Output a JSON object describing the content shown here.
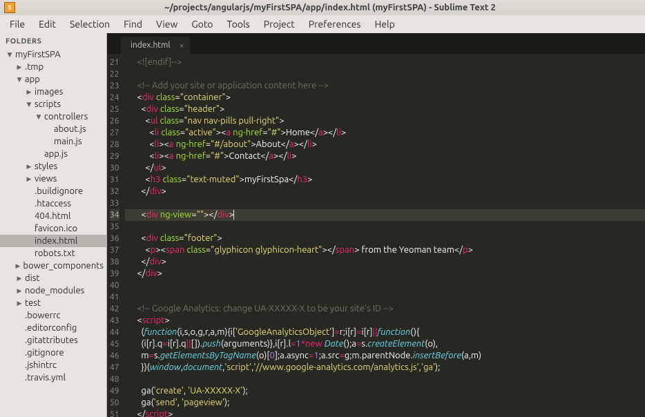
{
  "titlebar": {
    "icon_text": "S",
    "title": "~/projects/angularjs/myFirstSPA/app/index.html (myFirstSPA) - Sublime Text 2"
  },
  "menubar": [
    "File",
    "Edit",
    "Selection",
    "Find",
    "View",
    "Goto",
    "Tools",
    "Project",
    "Preferences",
    "Help"
  ],
  "sidebar": {
    "heading": "FOLDERS",
    "tree": [
      {
        "depth": 0,
        "arrow": "down",
        "label": "myFirstSPA"
      },
      {
        "depth": 1,
        "arrow": "right",
        "label": ".tmp"
      },
      {
        "depth": 1,
        "arrow": "down",
        "label": "app"
      },
      {
        "depth": 2,
        "arrow": "right",
        "label": "images"
      },
      {
        "depth": 2,
        "arrow": "down",
        "label": "scripts"
      },
      {
        "depth": 3,
        "arrow": "down",
        "label": "controllers"
      },
      {
        "depth": 4,
        "arrow": "",
        "label": "about.js"
      },
      {
        "depth": 4,
        "arrow": "",
        "label": "main.js"
      },
      {
        "depth": 3,
        "arrow": "",
        "label": "app.js"
      },
      {
        "depth": 2,
        "arrow": "right",
        "label": "styles"
      },
      {
        "depth": 2,
        "arrow": "right",
        "label": "views"
      },
      {
        "depth": 2,
        "arrow": "",
        "label": ".buildignore"
      },
      {
        "depth": 2,
        "arrow": "",
        "label": ".htaccess"
      },
      {
        "depth": 2,
        "arrow": "",
        "label": "404.html"
      },
      {
        "depth": 2,
        "arrow": "",
        "label": "favicon.ico"
      },
      {
        "depth": 2,
        "arrow": "",
        "label": "index.html",
        "selected": true
      },
      {
        "depth": 2,
        "arrow": "",
        "label": "robots.txt"
      },
      {
        "depth": 1,
        "arrow": "right",
        "label": "bower_components"
      },
      {
        "depth": 1,
        "arrow": "right",
        "label": "dist"
      },
      {
        "depth": 1,
        "arrow": "right",
        "label": "node_modules"
      },
      {
        "depth": 1,
        "arrow": "right",
        "label": "test"
      },
      {
        "depth": 1,
        "arrow": "",
        "label": ".bowerrc"
      },
      {
        "depth": 1,
        "arrow": "",
        "label": ".editorconfig"
      },
      {
        "depth": 1,
        "arrow": "",
        "label": ".gitattributes"
      },
      {
        "depth": 1,
        "arrow": "",
        "label": ".gitignore"
      },
      {
        "depth": 1,
        "arrow": "",
        "label": ".jshintrc"
      },
      {
        "depth": 1,
        "arrow": "",
        "label": ".travis.yml"
      }
    ]
  },
  "tab": {
    "label": "index.html"
  },
  "gutter": {
    "start": 21,
    "end": 51,
    "highlight": 34
  },
  "code_lines": [
    {
      "n": 21,
      "seg": [
        {
          "cls": "c-text",
          "t": "    "
        },
        {
          "cls": "c-comment",
          "t": "<![endif]-->"
        }
      ]
    },
    {
      "n": 22,
      "seg": []
    },
    {
      "n": 23,
      "seg": [
        {
          "cls": "c-text",
          "t": "    "
        },
        {
          "cls": "c-comment",
          "t": "<!-- Add your site or application content here -->"
        }
      ]
    },
    {
      "n": 24,
      "seg": [
        {
          "cls": "c-text",
          "t": "    "
        },
        {
          "cls": "c-punc",
          "t": "<"
        },
        {
          "cls": "c-tag",
          "t": "div"
        },
        {
          "cls": "c-text",
          "t": " "
        },
        {
          "cls": "c-attr",
          "t": "class"
        },
        {
          "cls": "c-punc",
          "t": "="
        },
        {
          "cls": "c-string",
          "t": "\"container\""
        },
        {
          "cls": "c-punc",
          "t": ">"
        }
      ]
    },
    {
      "n": 25,
      "seg": [
        {
          "cls": "c-text",
          "t": "      "
        },
        {
          "cls": "c-punc",
          "t": "<"
        },
        {
          "cls": "c-tag",
          "t": "div"
        },
        {
          "cls": "c-text",
          "t": " "
        },
        {
          "cls": "c-attr",
          "t": "class"
        },
        {
          "cls": "c-punc",
          "t": "="
        },
        {
          "cls": "c-string",
          "t": "\"header\""
        },
        {
          "cls": "c-punc",
          "t": ">"
        }
      ]
    },
    {
      "n": 26,
      "seg": [
        {
          "cls": "c-text",
          "t": "        "
        },
        {
          "cls": "c-punc",
          "t": "<"
        },
        {
          "cls": "c-tag",
          "t": "ul"
        },
        {
          "cls": "c-text",
          "t": " "
        },
        {
          "cls": "c-attr",
          "t": "class"
        },
        {
          "cls": "c-punc",
          "t": "="
        },
        {
          "cls": "c-string",
          "t": "\"nav nav-pills pull-right\""
        },
        {
          "cls": "c-punc",
          "t": ">"
        }
      ]
    },
    {
      "n": 27,
      "seg": [
        {
          "cls": "c-text",
          "t": "          "
        },
        {
          "cls": "c-punc",
          "t": "<"
        },
        {
          "cls": "c-tag",
          "t": "li"
        },
        {
          "cls": "c-text",
          "t": " "
        },
        {
          "cls": "c-attr",
          "t": "class"
        },
        {
          "cls": "c-punc",
          "t": "="
        },
        {
          "cls": "c-string",
          "t": "\"active\""
        },
        {
          "cls": "c-punc",
          "t": "><"
        },
        {
          "cls": "c-tag",
          "t": "a"
        },
        {
          "cls": "c-text",
          "t": " "
        },
        {
          "cls": "c-attr",
          "t": "ng-href"
        },
        {
          "cls": "c-punc",
          "t": "="
        },
        {
          "cls": "c-string",
          "t": "\"#\""
        },
        {
          "cls": "c-punc",
          "t": ">"
        },
        {
          "cls": "c-text",
          "t": "Home"
        },
        {
          "cls": "c-punc",
          "t": "</"
        },
        {
          "cls": "c-tag",
          "t": "a"
        },
        {
          "cls": "c-punc",
          "t": "></"
        },
        {
          "cls": "c-tag",
          "t": "li"
        },
        {
          "cls": "c-punc",
          "t": ">"
        }
      ]
    },
    {
      "n": 28,
      "seg": [
        {
          "cls": "c-text",
          "t": "          "
        },
        {
          "cls": "c-punc",
          "t": "<"
        },
        {
          "cls": "c-tag",
          "t": "li"
        },
        {
          "cls": "c-punc",
          "t": "><"
        },
        {
          "cls": "c-tag",
          "t": "a"
        },
        {
          "cls": "c-text",
          "t": " "
        },
        {
          "cls": "c-attr",
          "t": "ng-href"
        },
        {
          "cls": "c-punc",
          "t": "="
        },
        {
          "cls": "c-string",
          "t": "\"#/about\""
        },
        {
          "cls": "c-punc",
          "t": ">"
        },
        {
          "cls": "c-text",
          "t": "About"
        },
        {
          "cls": "c-punc",
          "t": "</"
        },
        {
          "cls": "c-tag",
          "t": "a"
        },
        {
          "cls": "c-punc",
          "t": "></"
        },
        {
          "cls": "c-tag",
          "t": "li"
        },
        {
          "cls": "c-punc",
          "t": ">"
        }
      ]
    },
    {
      "n": 29,
      "seg": [
        {
          "cls": "c-text",
          "t": "          "
        },
        {
          "cls": "c-punc",
          "t": "<"
        },
        {
          "cls": "c-tag",
          "t": "li"
        },
        {
          "cls": "c-punc",
          "t": "><"
        },
        {
          "cls": "c-tag",
          "t": "a"
        },
        {
          "cls": "c-text",
          "t": " "
        },
        {
          "cls": "c-attr",
          "t": "ng-href"
        },
        {
          "cls": "c-punc",
          "t": "="
        },
        {
          "cls": "c-string",
          "t": "\"#\""
        },
        {
          "cls": "c-punc",
          "t": ">"
        },
        {
          "cls": "c-text",
          "t": "Contact"
        },
        {
          "cls": "c-punc",
          "t": "</"
        },
        {
          "cls": "c-tag",
          "t": "a"
        },
        {
          "cls": "c-punc",
          "t": "></"
        },
        {
          "cls": "c-tag",
          "t": "li"
        },
        {
          "cls": "c-punc",
          "t": ">"
        }
      ]
    },
    {
      "n": 30,
      "seg": [
        {
          "cls": "c-text",
          "t": "        "
        },
        {
          "cls": "c-punc",
          "t": "</"
        },
        {
          "cls": "c-tag",
          "t": "ul"
        },
        {
          "cls": "c-punc",
          "t": ">"
        }
      ]
    },
    {
      "n": 31,
      "seg": [
        {
          "cls": "c-text",
          "t": "        "
        },
        {
          "cls": "c-punc",
          "t": "<"
        },
        {
          "cls": "c-tag",
          "t": "h3"
        },
        {
          "cls": "c-text",
          "t": " "
        },
        {
          "cls": "c-attr",
          "t": "class"
        },
        {
          "cls": "c-punc",
          "t": "="
        },
        {
          "cls": "c-string",
          "t": "\"text-muted\""
        },
        {
          "cls": "c-punc",
          "t": ">"
        },
        {
          "cls": "c-text",
          "t": "myFirstSpa"
        },
        {
          "cls": "c-punc",
          "t": "</"
        },
        {
          "cls": "c-tag",
          "t": "h3"
        },
        {
          "cls": "c-punc",
          "t": ">"
        }
      ]
    },
    {
      "n": 32,
      "seg": [
        {
          "cls": "c-text",
          "t": "      "
        },
        {
          "cls": "c-punc",
          "t": "</"
        },
        {
          "cls": "c-tag",
          "t": "div"
        },
        {
          "cls": "c-punc",
          "t": ">"
        }
      ]
    },
    {
      "n": 33,
      "seg": []
    },
    {
      "n": 34,
      "hl": true,
      "seg": [
        {
          "cls": "c-text",
          "t": "      "
        },
        {
          "cls": "c-punc",
          "t": "<"
        },
        {
          "cls": "c-tag",
          "t": "div"
        },
        {
          "cls": "c-text",
          "t": " "
        },
        {
          "cls": "c-attr",
          "t": "ng-view"
        },
        {
          "cls": "c-punc",
          "t": "="
        },
        {
          "cls": "c-string",
          "t": "\"\""
        },
        {
          "cls": "c-punc",
          "t": "></"
        },
        {
          "cls": "c-tag",
          "t": "div"
        },
        {
          "cls": "c-punc",
          "t": ">"
        },
        {
          "cls": "cursor",
          "t": ""
        }
      ]
    },
    {
      "n": 35,
      "seg": []
    },
    {
      "n": 36,
      "seg": [
        {
          "cls": "c-text",
          "t": "      "
        },
        {
          "cls": "c-punc",
          "t": "<"
        },
        {
          "cls": "c-tag",
          "t": "div"
        },
        {
          "cls": "c-text",
          "t": " "
        },
        {
          "cls": "c-attr",
          "t": "class"
        },
        {
          "cls": "c-punc",
          "t": "="
        },
        {
          "cls": "c-string",
          "t": "\"footer\""
        },
        {
          "cls": "c-punc",
          "t": ">"
        }
      ]
    },
    {
      "n": 37,
      "seg": [
        {
          "cls": "c-text",
          "t": "        "
        },
        {
          "cls": "c-punc",
          "t": "<"
        },
        {
          "cls": "c-tag",
          "t": "p"
        },
        {
          "cls": "c-punc",
          "t": "><"
        },
        {
          "cls": "c-tag",
          "t": "span"
        },
        {
          "cls": "c-text",
          "t": " "
        },
        {
          "cls": "c-attr",
          "t": "class"
        },
        {
          "cls": "c-punc",
          "t": "="
        },
        {
          "cls": "c-string",
          "t": "\"glyphicon glyphicon-heart\""
        },
        {
          "cls": "c-punc",
          "t": "></"
        },
        {
          "cls": "c-tag",
          "t": "span"
        },
        {
          "cls": "c-punc",
          "t": ">"
        },
        {
          "cls": "c-text",
          "t": " from the Yeoman team"
        },
        {
          "cls": "c-punc",
          "t": "</"
        },
        {
          "cls": "c-tag",
          "t": "p"
        },
        {
          "cls": "c-punc",
          "t": ">"
        }
      ]
    },
    {
      "n": 38,
      "seg": [
        {
          "cls": "c-text",
          "t": "      "
        },
        {
          "cls": "c-punc",
          "t": "</"
        },
        {
          "cls": "c-tag",
          "t": "div"
        },
        {
          "cls": "c-punc",
          "t": ">"
        }
      ]
    },
    {
      "n": 39,
      "seg": [
        {
          "cls": "c-text",
          "t": "    "
        },
        {
          "cls": "c-punc",
          "t": "</"
        },
        {
          "cls": "c-tag",
          "t": "div"
        },
        {
          "cls": "c-punc",
          "t": ">"
        }
      ]
    },
    {
      "n": 40,
      "seg": []
    },
    {
      "n": 41,
      "seg": []
    },
    {
      "n": 42,
      "seg": [
        {
          "cls": "c-text",
          "t": "    "
        },
        {
          "cls": "c-comment",
          "t": "<!-- Google Analytics: change UA-XXXXX-X to be your site's ID -->"
        }
      ]
    },
    {
      "n": 43,
      "seg": [
        {
          "cls": "c-text",
          "t": "    "
        },
        {
          "cls": "c-punc",
          "t": "<"
        },
        {
          "cls": "c-tag",
          "t": "script"
        },
        {
          "cls": "c-punc",
          "t": ">"
        }
      ]
    },
    {
      "n": 44,
      "seg": [
        {
          "cls": "c-text",
          "t": "      ("
        },
        {
          "cls": "c-func",
          "t": "function"
        },
        {
          "cls": "c-text",
          "t": "(i,s,o,g,r,a,m){i["
        },
        {
          "cls": "c-string",
          "t": "'GoogleAnalyticsObject'"
        },
        {
          "cls": "c-text",
          "t": "]"
        },
        {
          "cls": "c-op",
          "t": "="
        },
        {
          "cls": "c-text",
          "t": "r;i[r]"
        },
        {
          "cls": "c-op",
          "t": "="
        },
        {
          "cls": "c-text",
          "t": "i[r]"
        },
        {
          "cls": "c-op",
          "t": "||"
        },
        {
          "cls": "c-func",
          "t": "function"
        },
        {
          "cls": "c-text",
          "t": "(){"
        }
      ]
    },
    {
      "n": 45,
      "seg": [
        {
          "cls": "c-text",
          "t": "      (i[r].q"
        },
        {
          "cls": "c-op",
          "t": "="
        },
        {
          "cls": "c-text",
          "t": "i[r].q"
        },
        {
          "cls": "c-op",
          "t": "||"
        },
        {
          "cls": "c-text",
          "t": "[])."
        },
        {
          "cls": "c-keyword",
          "t": "push"
        },
        {
          "cls": "c-text",
          "t": "(arguments)},i[r].l"
        },
        {
          "cls": "c-op",
          "t": "="
        },
        {
          "cls": "c-num",
          "t": "1"
        },
        {
          "cls": "c-op",
          "t": "*new"
        },
        {
          "cls": "c-text",
          "t": " "
        },
        {
          "cls": "c-keyword",
          "t": "Date"
        },
        {
          "cls": "c-text",
          "t": "();a"
        },
        {
          "cls": "c-op",
          "t": "="
        },
        {
          "cls": "c-text",
          "t": "s."
        },
        {
          "cls": "c-keyword",
          "t": "createElement"
        },
        {
          "cls": "c-text",
          "t": "(o),"
        }
      ]
    },
    {
      "n": 46,
      "seg": [
        {
          "cls": "c-text",
          "t": "      m"
        },
        {
          "cls": "c-op",
          "t": "="
        },
        {
          "cls": "c-text",
          "t": "s."
        },
        {
          "cls": "c-keyword",
          "t": "getElementsByTagName"
        },
        {
          "cls": "c-text",
          "t": "(o)["
        },
        {
          "cls": "c-num",
          "t": "0"
        },
        {
          "cls": "c-text",
          "t": "];a.async"
        },
        {
          "cls": "c-op",
          "t": "="
        },
        {
          "cls": "c-num",
          "t": "1"
        },
        {
          "cls": "c-text",
          "t": ";a.src"
        },
        {
          "cls": "c-op",
          "t": "="
        },
        {
          "cls": "c-text",
          "t": "g;m.parentNode."
        },
        {
          "cls": "c-keyword",
          "t": "insertBefore"
        },
        {
          "cls": "c-text",
          "t": "(a,m)"
        }
      ]
    },
    {
      "n": 47,
      "seg": [
        {
          "cls": "c-text",
          "t": "      })("
        },
        {
          "cls": "c-keyword",
          "t": "window"
        },
        {
          "cls": "c-text",
          "t": ","
        },
        {
          "cls": "c-keyword",
          "t": "document"
        },
        {
          "cls": "c-text",
          "t": ","
        },
        {
          "cls": "c-string",
          "t": "'script'"
        },
        {
          "cls": "c-text",
          "t": ","
        },
        {
          "cls": "c-string",
          "t": "'//www.google-analytics.com/analytics.js'"
        },
        {
          "cls": "c-text",
          "t": ","
        },
        {
          "cls": "c-string",
          "t": "'ga'"
        },
        {
          "cls": "c-text",
          "t": ");"
        }
      ]
    },
    {
      "n": 48,
      "seg": []
    },
    {
      "n": 49,
      "seg": [
        {
          "cls": "c-text",
          "t": "      ga("
        },
        {
          "cls": "c-string",
          "t": "'create'"
        },
        {
          "cls": "c-text",
          "t": ", "
        },
        {
          "cls": "c-string",
          "t": "'UA-XXXXX-X'"
        },
        {
          "cls": "c-text",
          "t": ");"
        }
      ]
    },
    {
      "n": 50,
      "seg": [
        {
          "cls": "c-text",
          "t": "      ga("
        },
        {
          "cls": "c-string",
          "t": "'send'"
        },
        {
          "cls": "c-text",
          "t": ", "
        },
        {
          "cls": "c-string",
          "t": "'pageview'"
        },
        {
          "cls": "c-text",
          "t": ");"
        }
      ]
    },
    {
      "n": 51,
      "seg": [
        {
          "cls": "c-text",
          "t": "    "
        },
        {
          "cls": "c-punc",
          "t": "</"
        },
        {
          "cls": "c-tag",
          "t": "script"
        },
        {
          "cls": "c-punc",
          "t": ">"
        }
      ]
    }
  ]
}
